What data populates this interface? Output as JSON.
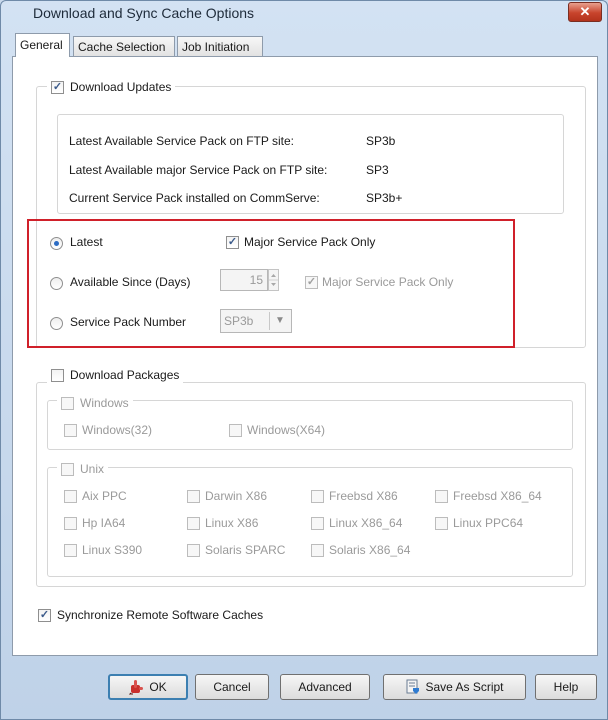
{
  "window": {
    "title": "Download and Sync Cache Options",
    "close_glyph": "✕"
  },
  "tabs": [
    {
      "label": "General"
    },
    {
      "label": "Cache Selection"
    },
    {
      "label": "Job Initiation"
    }
  ],
  "download_updates": {
    "label": "Download Updates",
    "checked": true,
    "info": [
      {
        "label": "Latest Available Service Pack on FTP site:",
        "value": "SP3b"
      },
      {
        "label": "Latest Available major Service Pack on FTP site:",
        "value": "SP3"
      },
      {
        "label": "Current Service Pack installed on CommServe:",
        "value": "SP3b+"
      }
    ],
    "options": {
      "latest_label": "Latest",
      "major_only_label": "Major Service Pack Only",
      "available_since_label": "Available Since (Days)",
      "days_value": "15",
      "major_only_label_2": "Major Service Pack Only",
      "sp_number_label": "Service Pack Number",
      "sp_number_value": "SP3b",
      "selected": "latest"
    }
  },
  "download_packages": {
    "label": "Download Packages",
    "checked": false,
    "windows": {
      "label": "Windows",
      "items": [
        "Windows(32)",
        "Windows(X64)"
      ]
    },
    "unix": {
      "label": "Unix",
      "items": [
        "Aix PPC",
        "Darwin X86",
        "Freebsd X86",
        "Freebsd X86_64",
        "Hp IA64",
        "Linux X86",
        "Linux X86_64",
        "Linux PPC64",
        "Linux S390",
        "Solaris SPARC",
        "Solaris X86_64"
      ]
    }
  },
  "sync": {
    "label": "Synchronize Remote Software Caches",
    "checked": true
  },
  "buttons": {
    "ok": "OK",
    "cancel": "Cancel",
    "advanced": "Advanced",
    "save_as_script": "Save As Script",
    "help": "Help"
  },
  "check_glyph": "✓",
  "dropdown_glyph": "▼"
}
